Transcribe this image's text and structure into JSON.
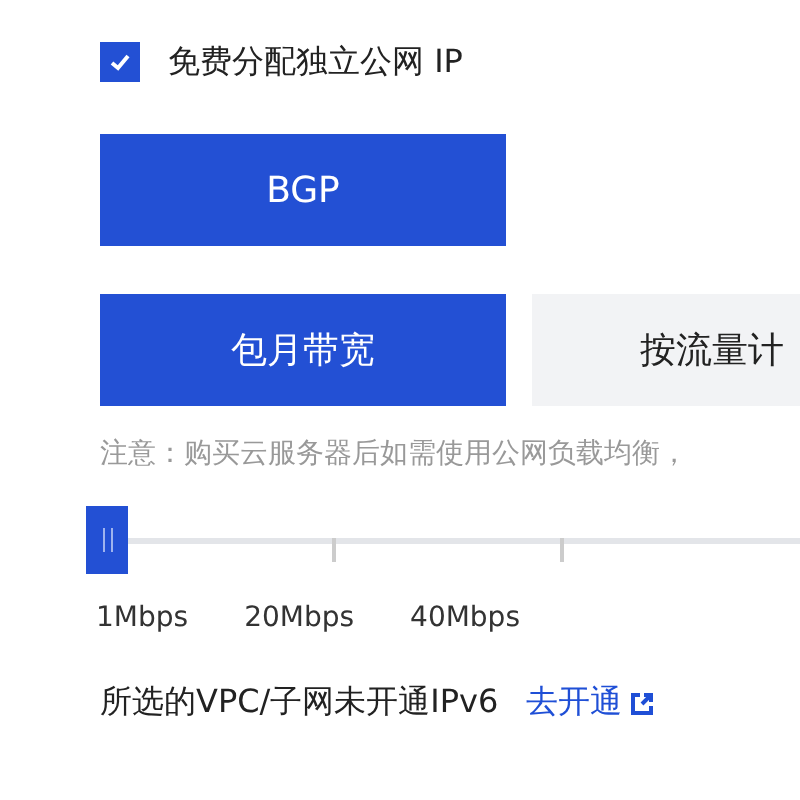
{
  "public_ip": {
    "label": "免费分配独立公网 IP",
    "checked": true
  },
  "line_type": {
    "label": "BGP",
    "selected": true
  },
  "billing_tabs": [
    {
      "label": "包月带宽",
      "selected": true
    },
    {
      "label": "按流量计",
      "selected": false
    }
  ],
  "note": "注意：购买云服务器后如需使用公网负载均衡，",
  "bandwidth_slider": {
    "level": 0,
    "ticks": [
      {
        "label": "1Mbps"
      },
      {
        "label": "20Mbps"
      },
      {
        "label": "40Mbps"
      }
    ]
  },
  "ipv6": {
    "message": "所选的VPC/子网未开通IPv6",
    "link": "去开通"
  }
}
